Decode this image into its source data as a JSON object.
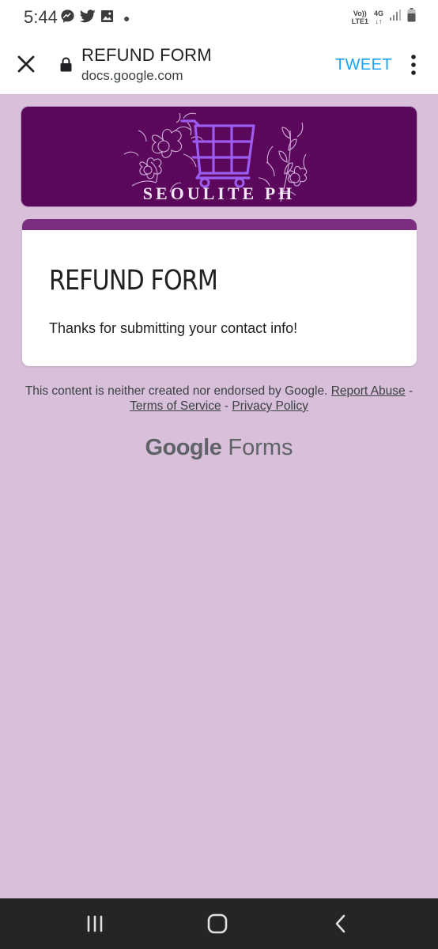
{
  "status_bar": {
    "time": "5:44",
    "notification_icons": [
      "messenger-icon",
      "twitter-icon",
      "gallery-icon"
    ],
    "network_top": "Vo))",
    "network_bottom": "LTE1",
    "network_type": "4G"
  },
  "toolbar": {
    "title": "REFUND FORM",
    "url": "docs.google.com",
    "action_label": "TWEET"
  },
  "banner": {
    "brand_text": "SEOULITE PH",
    "background_color": "#5b075b"
  },
  "card": {
    "title": "REFUND FORM",
    "message": "Thanks for submitting your contact info!",
    "accent_color": "#7b2e80"
  },
  "footer": {
    "disclaimer": "This content is neither created nor endorsed by Google.",
    "report_abuse": "Report Abuse",
    "separator": "-",
    "terms": "Terms of Service",
    "privacy": "Privacy Policy",
    "logo_google": "Google",
    "logo_forms": "Forms"
  },
  "colors": {
    "page_background": "#d8c0da",
    "tweet_blue": "#1da1f2",
    "nav_bar": "#252525"
  }
}
